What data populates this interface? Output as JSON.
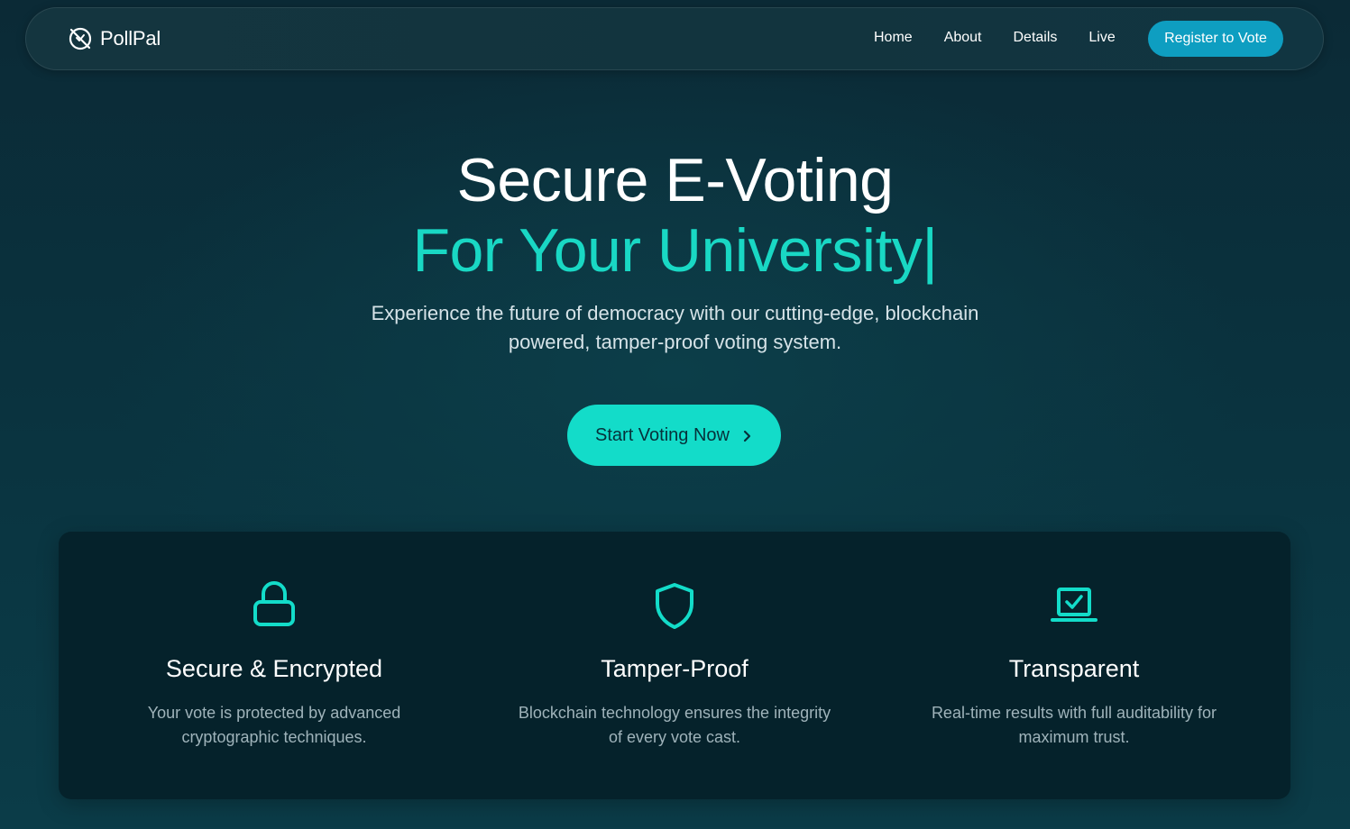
{
  "brand": {
    "name": "PollPal",
    "icon": "ban-circle-icon"
  },
  "nav": {
    "links": [
      "Home",
      "About",
      "Details",
      "Live"
    ],
    "register_label": "Register to Vote"
  },
  "hero": {
    "title": "Secure E-Voting",
    "subtitle": "For Your University|",
    "description": "Experience the future of democracy with our cutting-edge, blockchain powered, tamper-proof voting system.",
    "cta_label": "Start Voting Now",
    "cta_icon": "chevron-right-icon"
  },
  "features": [
    {
      "icon": "lock-icon",
      "title": "Secure & Encrypted",
      "description": "Your vote is protected by advanced cryptographic techniques."
    },
    {
      "icon": "shield-icon",
      "title": "Tamper-Proof",
      "description": "Blockchain technology ensures the integrity of every vote cast."
    },
    {
      "icon": "laptop-check-icon",
      "title": "Transparent",
      "description": "Real-time results with full auditability for maximum trust."
    }
  ],
  "colors": {
    "accent": "#13dcc9",
    "accent_text": "#19d8c4",
    "register_button": "#0e9ec1",
    "panel": "#05222b",
    "background": "#0b2f3b"
  }
}
